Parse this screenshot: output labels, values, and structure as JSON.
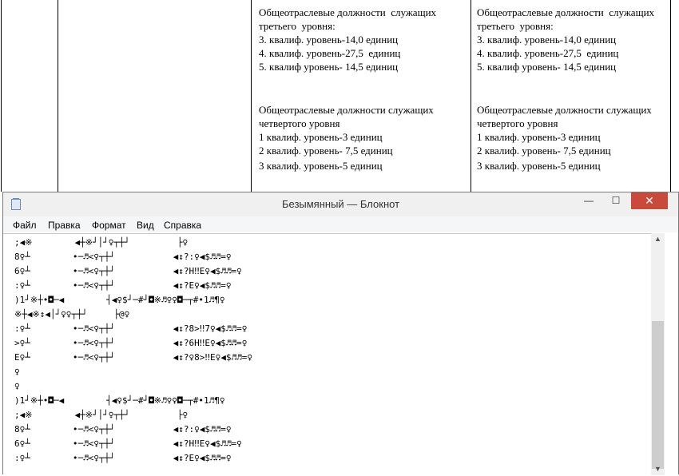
{
  "document": {
    "col3": {
      "block1": [
        "Общеотраслевые должности  служащих",
        "третьего  уровня:",
        "3. квалиф. уровень-14,0 единиц",
        "4. квалиф. уровень-27,5  единиц",
        "5. квалиф уровень- 14,5 единиц"
      ],
      "block2": [
        "Общеотраслевые должности служащих",
        "четвертого уровня",
        "1 квалиф. уровень-3 единиц",
        "2 квалиф. уровень- 7,5 единиц",
        "3 квалиф. уровень-5 единиц"
      ]
    },
    "col4": {
      "block1": [
        "Общеотраслевые должности  служащих",
        "третьего  уровня:",
        "3. квалиф. уровень-14,0 единиц",
        "4. квалиф. уровень-27,5  единиц",
        "5. квалиф уровень- 14,5 единиц"
      ],
      "block2": [
        "Общеотраслевые должности служащих",
        "четвертого уровня",
        "1 квалиф. уровень-3 единиц",
        "2 квалиф. уровень- 7,5 единиц",
        "3 квалиф. уровень-5 единиц"
      ]
    }
  },
  "window": {
    "title": "Безымянный — Блокнот",
    "icon": "notepad-icon",
    "controls": {
      "minimize": "—",
      "maximize": "☐",
      "close": "✕"
    }
  },
  "menu": [
    "Файл",
    "Правка",
    "Формат",
    "Вид",
    "Справка"
  ],
  "editor": {
    "lines": [
      ";◀※        ◀┼※┘│┘♀┬┼┘         ├♀",
      "8♀┴        •─♬<♀┬┼┘           ◀↕?:♀◀$♬♬=♀",
      "6♀┴        •─♬<♀┬┼┘           ◀↕?H‼E♀◀$♬♬=♀",
      ":♀┴        •─♬<♀┬┼┘           ◀↕?E♀◀$♬♬=♀",
      ")1┘※┼•◘─◀        ┤◀♀$┘─#┘◘※♬♀♀◘─┬#•1♬¶♀",
      "※┼◀※↕◀│┘♀♀┬┼┘     ├@♀",
      ":♀┴        •─♬<♀┬┼┘           ◀↕?8>‼7♀◀$♬♬=♀",
      ">♀┴        •─♬<♀┬┼┘           ◀↕?6H‼E♀◀$♬♬=♀",
      "E♀┴        •─♬<♀┬┼┘           ◀↕?♀8>‼E♀◀$♬♬=♀",
      "♀",
      "♀",
      ")1┘※┼•◘─◀        ┤◀♀$┘─#┘◘※♬♀♀◘─┬#•1♬¶♀",
      ";◀※        ◀┼※┘│┘♀┬┼┘         ├♀",
      "8♀┴        •─♬<♀┬┼┘           ◀↕?:♀◀$♬♬=♀",
      "6♀┴        •─♬<♀┬┼┘           ◀↕?H‼E♀◀$♬♬=♀",
      ":♀┴        •─♬<♀┬┼┘           ◀↕?E♀◀$♬♬=♀"
    ]
  },
  "scrollbar": {
    "up": "▲",
    "down": "▼"
  }
}
